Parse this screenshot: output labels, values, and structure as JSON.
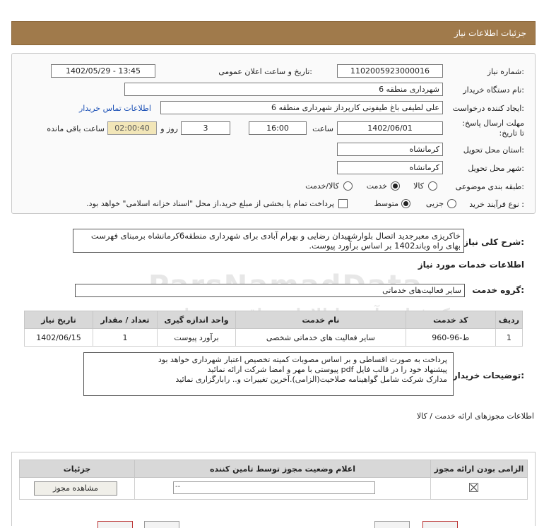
{
  "header": {
    "title": "جزئیات اطلاعات نیاز"
  },
  "form": {
    "need_number_label": "شماره نیاز:",
    "need_number": "1102005923000016",
    "announce_label": "تاریخ و ساعت اعلان عمومی:",
    "announce_value": "1402/05/29 - 13:45",
    "buyer_org_label": "نام دستگاه خریدار:",
    "buyer_org": "شهرداری منطقه 6",
    "creator_label": "ایجاد کننده درخواست:",
    "creator": "علی لطیفی باغ طیفونی کارپرداز شهرداری منطقه 6",
    "contact_link": "اطلاعات تماس خریدار",
    "deadline_label": "مهلت ارسال پاسخ: تا تاریخ:",
    "deadline_date": "1402/06/01",
    "time_label": "ساعت",
    "deadline_time": "16:00",
    "days_value": "3",
    "days_label": "روز و",
    "remaining_value": "02:00:40",
    "remaining_label": "ساعت باقی مانده",
    "province_label": "استان محل تحویل:",
    "province": "کرمانشاه",
    "city_label": "شهر محل تحویل:",
    "city": "کرمانشاه",
    "category_label": "طبقه بندی موضوعی:",
    "category_options": [
      "کالا",
      "خدمت",
      "کالا/خدمت"
    ],
    "category_selected": "خدمت",
    "process_label": "نوع فرآیند خرید :",
    "process_options": [
      "جزیی",
      "متوسط"
    ],
    "process_selected": "متوسط",
    "payment_note": "پرداخت تمام یا بخشی از مبلغ خرید،از محل \"اسناد خزانه اسلامی\" خواهد بود."
  },
  "summary": {
    "label": "شرح کلی نیاز:",
    "text": "خاکریزی معبرجدید اتصال بلوارشهیدان رضایی و بهرام آبادی برای شهرداری منطقه6کرمانشاه برمبنای فهرست بهای راه وباند1402 بر اساس برآورد پیوست."
  },
  "services": {
    "section_title": "اطلاعات خدمات مورد نیاز",
    "group_label": "گروه خدمت:",
    "group_value": "سایر فعالیت‌های خدماتی",
    "columns": [
      "ردیف",
      "کد خدمت",
      "نام خدمت",
      "واحد اندازه گیری",
      "تعداد / مقدار",
      "تاریخ نیاز"
    ],
    "rows": [
      {
        "row": "1",
        "code": "ط-96-960",
        "name": "سایر فعالیت های خدماتی شخصی",
        "unit": "برآورد پیوست",
        "qty": "1",
        "date": "1402/06/15"
      }
    ]
  },
  "buyer_notes": {
    "label": "توضیحات خریدار:",
    "lines": [
      "پرداخت به صورت اقساطی و بر اساس مصوبات کمیته تخصیص اعتبار شهرداری خواهد بود",
      "پیشنهاد خود را در قالب فایل pdf پیوستی با مهر و امضا شرکت ارائه نمائید",
      "مدارک شرکت شامل گواهینامه صلاحیت(الزامی).آخرین تغییرات و.. رابارگزاری نمائید"
    ]
  },
  "permits": {
    "section_title": "اطلاعات مجوزهای ارائه خدمت / کالا",
    "columns": [
      "الزامی بودن ارائه مجوز",
      "اعلام وضعیت مجوز توسط تامین کننده",
      "جزئیات"
    ],
    "select_value": "--",
    "view_button": "مشاهده مجوز"
  },
  "watermark": {
    "line1": "ParsNamadData",
    "line2": "مرکز فراهم آوری اطلاعات مناقصه و مزایده"
  }
}
